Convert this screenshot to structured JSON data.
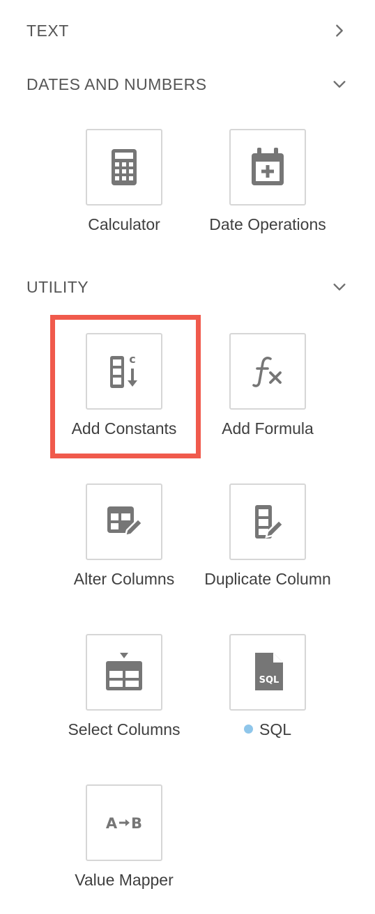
{
  "sections": {
    "text": {
      "title": "TEXT",
      "state": "collapsed"
    },
    "dates_numbers": {
      "title": "DATES AND NUMBERS",
      "state": "expanded"
    },
    "utility": {
      "title": "UTILITY",
      "state": "expanded"
    }
  },
  "tools": {
    "calculator": {
      "label": "Calculator",
      "icon": "calculator-icon"
    },
    "date_operations": {
      "label": "Date Operations",
      "icon": "calendar-plus-icon"
    },
    "add_constants": {
      "label": "Add Constants",
      "icon": "add-constants-icon",
      "highlighted": true
    },
    "add_formula": {
      "label": "Add Formula",
      "icon": "formula-fx-icon"
    },
    "alter_columns": {
      "label": "Alter Columns",
      "icon": "table-edit-icon"
    },
    "duplicate_column": {
      "label": "Duplicate Column",
      "icon": "column-edit-icon"
    },
    "select_columns": {
      "label": "Select Columns",
      "icon": "select-columns-icon"
    },
    "sql": {
      "label": "SQL",
      "icon": "sql-file-icon",
      "status_dot": "#8fc6ea"
    },
    "value_mapper": {
      "label": "Value Mapper",
      "icon": "a-to-b-icon",
      "icon_text_a": "A",
      "icon_text_b": "B"
    }
  },
  "colors": {
    "icon": "#767676",
    "tile_border": "#d6d6d6",
    "highlight": "#f05a4c",
    "header_text": "#555555"
  }
}
